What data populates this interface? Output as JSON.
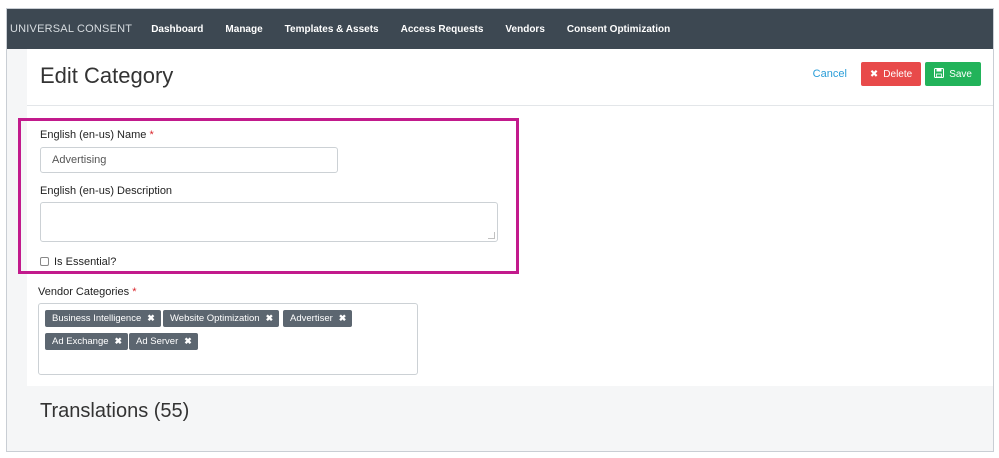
{
  "nav": {
    "brand": "UNIVERSAL CONSENT",
    "items": [
      {
        "label": "Dashboard"
      },
      {
        "label": "Manage"
      },
      {
        "label": "Templates & Assets"
      },
      {
        "label": "Access Requests"
      },
      {
        "label": "Vendors"
      },
      {
        "label": "Consent Optimization"
      }
    ]
  },
  "page": {
    "title": "Edit Category",
    "actions": {
      "cancel": "Cancel",
      "delete": "Delete",
      "save": "Save"
    }
  },
  "form": {
    "name_label": "English (en-us) Name",
    "name_value": "Advertising",
    "required_mark": "*",
    "description_label": "English (en-us) Description",
    "description_value": "",
    "essential_label": "Is Essential?",
    "essential_checked": false,
    "vendor_categories_label": "Vendor Categories",
    "vendor_categories": [
      {
        "label": "Business Intelligence"
      },
      {
        "label": "Website Optimization"
      },
      {
        "label": "Advertiser"
      },
      {
        "label": "Ad Exchange"
      },
      {
        "label": "Ad Server"
      }
    ],
    "tag_remove_glyph": "✖"
  },
  "translations": {
    "title": "Translations (55)"
  },
  "colors": {
    "nav_bg": "#3d4852",
    "accent_link": "#2a9dd8",
    "delete": "#e84a4a",
    "save": "#22b35a",
    "highlight": "#c21a8c",
    "tag_bg": "#5c6670"
  }
}
